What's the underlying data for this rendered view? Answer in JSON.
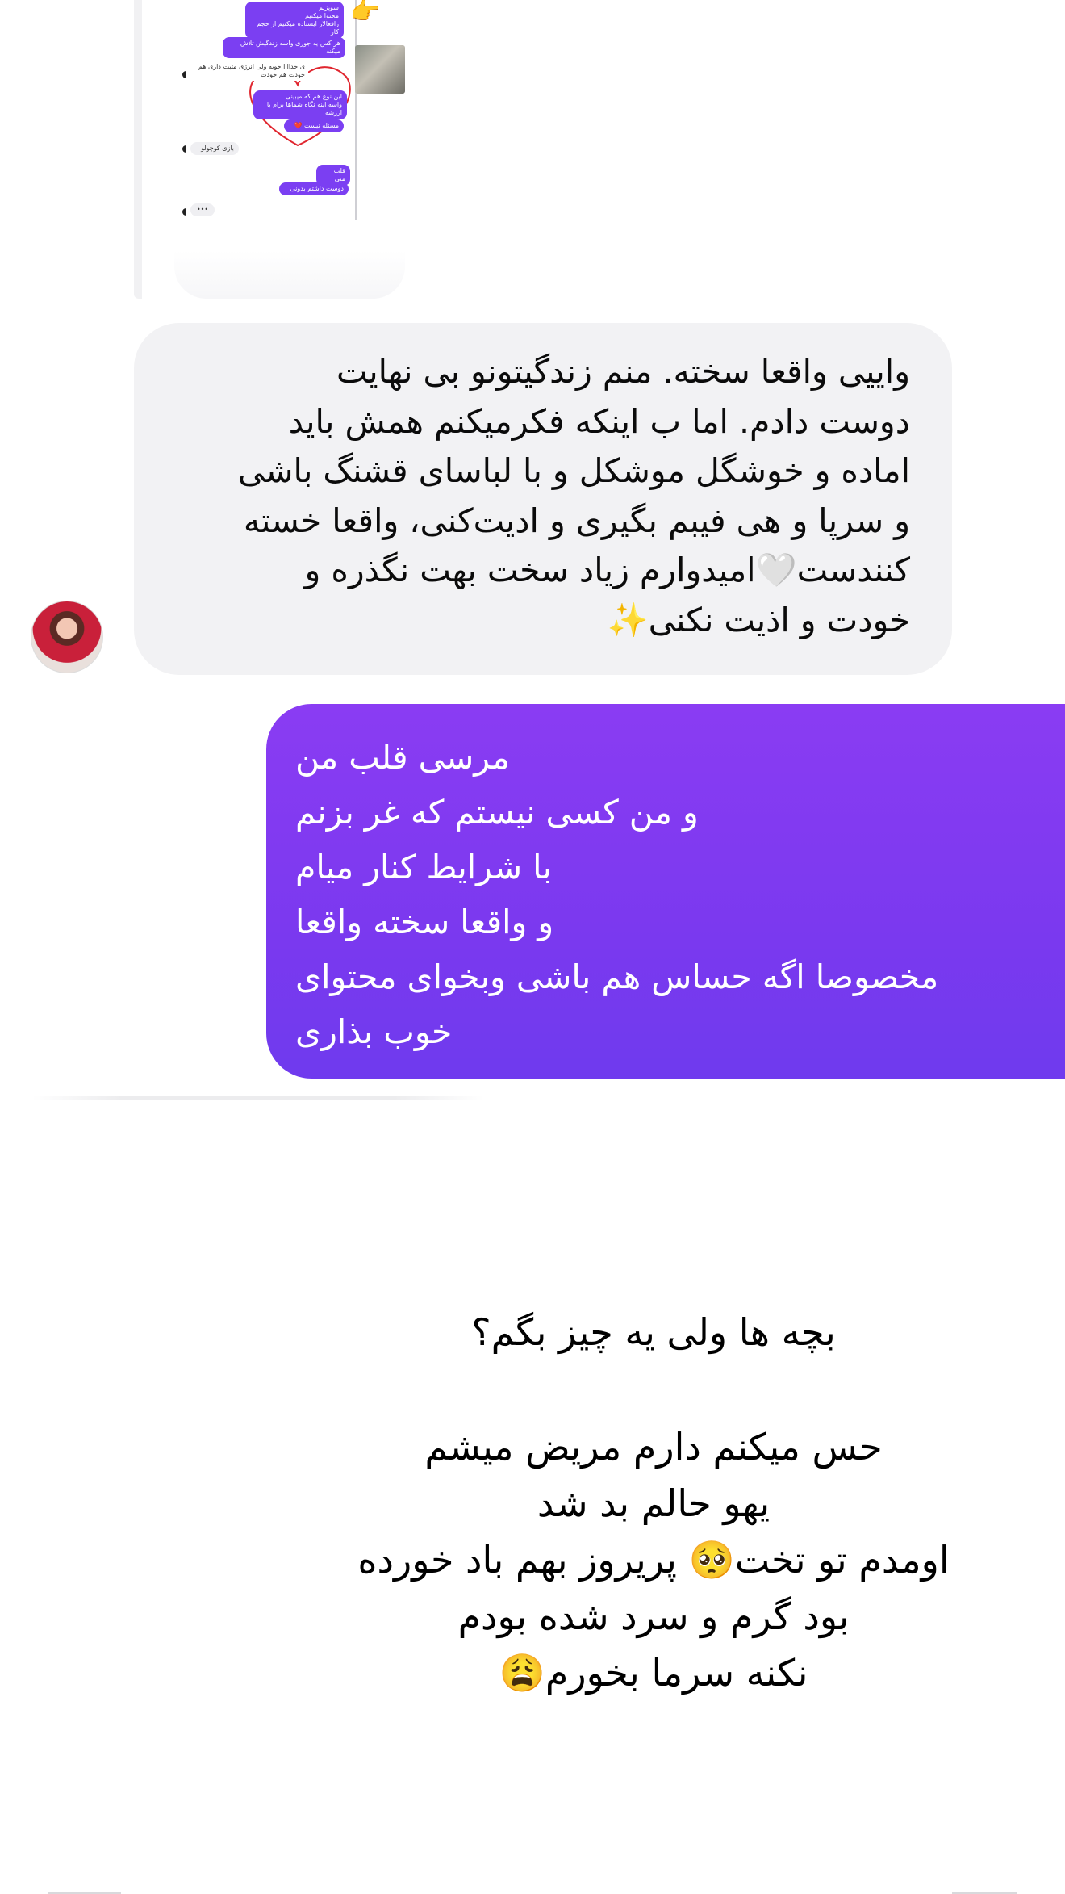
{
  "shared_screenshot": {
    "messages": [
      {
        "side": "out",
        "text": "سوپزیم\nمحتوا میکنیم\nرافعالار ایستاده میکنیم از حجم کار"
      },
      {
        "side": "out",
        "text": "هر کس یه جوری واسه زندگیش تلاش میکنه"
      },
      {
        "side": "in",
        "text": "ی خداااا خوبه ولی انرژی مثبت داری هم خودت هم خودت"
      },
      {
        "side": "out",
        "text": "این نوع هم که میبینی\nواسه اینه نگاه شماها برام با ارزشه"
      },
      {
        "side": "out",
        "text": "مسئله نیست ❤️"
      },
      {
        "side": "in",
        "text": "بازی کوچولو"
      },
      {
        "side": "out",
        "text": "قلب منی"
      },
      {
        "side": "out",
        "text": "دوست داشتم بدونی"
      },
      {
        "side": "in",
        "text": "•••"
      }
    ],
    "hand_icon": "pointing-hand-icon"
  },
  "received_message": {
    "lines": [
      "واییی واقعا سخته. منم زندگیتونو بی نهایت",
      "دوست دادم. اما ب اینکه فکرمیکنم همش باید",
      "اماده و خوشگل موشکل و با لباسای قشنگ باشی",
      "و سرپا و هی فیبم بگیری و ادیت‌کنی، واقعا خسته",
      "کنندست🤍امیدوارم زیاد سخت بهت نگذره و",
      "خودت و اذیت نکنی✨"
    ],
    "avatar_icon": "profile-avatar-icon"
  },
  "sent_message": {
    "lines": [
      "مرسی قلب من",
      "و من کسی نیستم که غر بزنم",
      "با شرایط کنار میام",
      "و واقعا سخته واقعا",
      "مخصوصا اگه حساس هم باشی وبخوای محتوای",
      "خوب بذاری"
    ]
  },
  "story": {
    "heading": "بچه ها ولی یه چیز بگم؟",
    "lines": [
      "حس میکنم دارم مریض میشم",
      "یهو حالم بد شد",
      "اومدم تو تخت🥺 پریروز بهم باد خورده",
      "بود گرم و سرد شده بودم",
      "نکنه سرما بخورم😩"
    ]
  },
  "colors": {
    "sent_bubble": "#7b39ef",
    "received_bubble": "#f2f2f4",
    "background": "#ffffff"
  }
}
